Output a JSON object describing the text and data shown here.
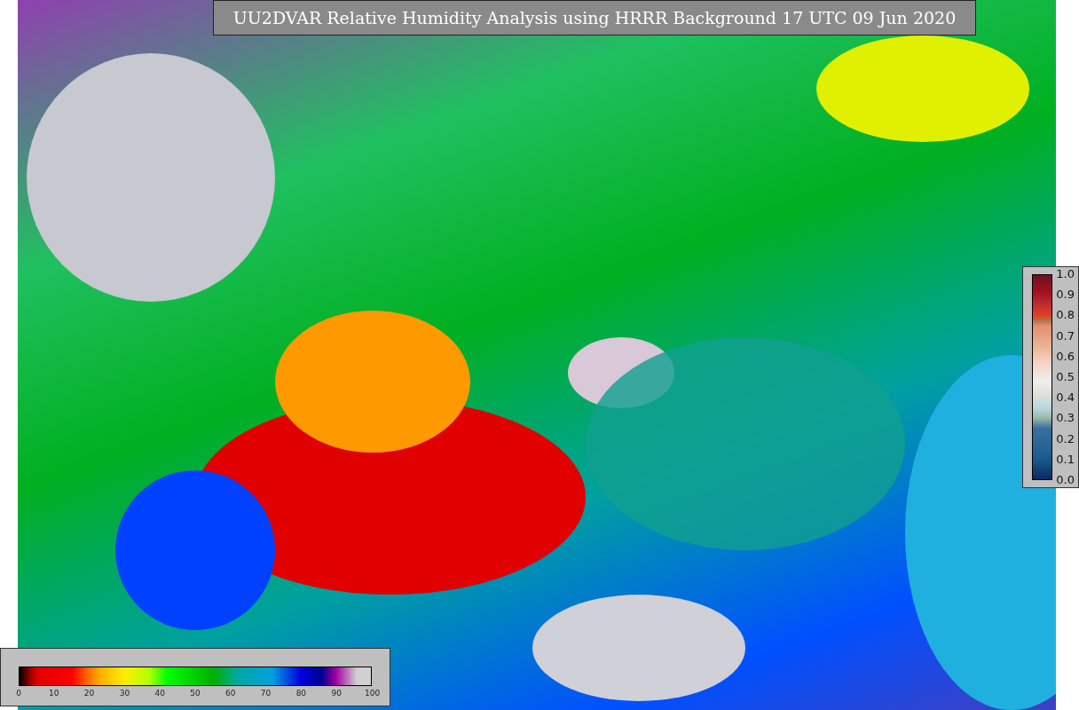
{
  "title": "UU2DVAR Relative Humidity Analysis using HRRR Background 17 UTC 09 Jun 2020",
  "increment_colorbar": {
    "ticks": [
      "1.0",
      "0.9",
      "0.8",
      "0.7",
      "0.6",
      "0.5",
      "0.4",
      "0.3",
      "0.2",
      "0.1",
      "0.0"
    ]
  },
  "humidity_colorbar": {
    "ticks": [
      "0",
      "10",
      "20",
      "30",
      "40",
      "50",
      "60",
      "70",
      "80",
      "90",
      "100"
    ]
  }
}
